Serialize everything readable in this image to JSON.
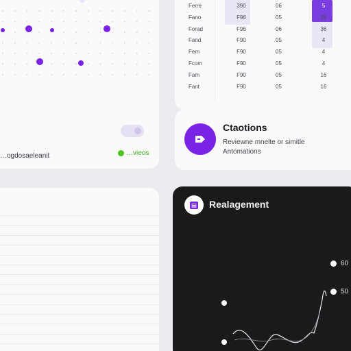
{
  "colors": {
    "accent": "#7a22e6",
    "dot_purple": "#7a22e6",
    "status_green": "#4ec21e",
    "dark_card": "#1a1a1c"
  },
  "dots_card": {
    "bottom_label": "…ogdosaeleanit",
    "status_text": "…vieos"
  },
  "table": {
    "rows": [
      [
        "Ferre",
        "390",
        "06",
        "5"
      ],
      [
        "Fano",
        "F96",
        "05",
        "26"
      ],
      [
        "Forad",
        "F96",
        "06",
        "36"
      ],
      [
        "Fand",
        "F90",
        "05",
        "4"
      ],
      [
        "Fem",
        "F90",
        "05",
        "4"
      ],
      [
        "Fcom",
        "F90",
        "05",
        "4"
      ],
      [
        "Fam",
        "F90",
        "05",
        "16"
      ],
      [
        "Fant",
        "F90",
        "05",
        "16"
      ]
    ]
  },
  "caption_card": {
    "icon": "send-arrow-icon",
    "title": "Ctaotions",
    "line1": "Reviewne mnelte or simitle",
    "line2": "Antomations"
  },
  "dark_card": {
    "icon": "list-icon",
    "title": "Realagement",
    "legend": [
      {
        "label": "60"
      },
      {
        "label": "50"
      }
    ]
  }
}
